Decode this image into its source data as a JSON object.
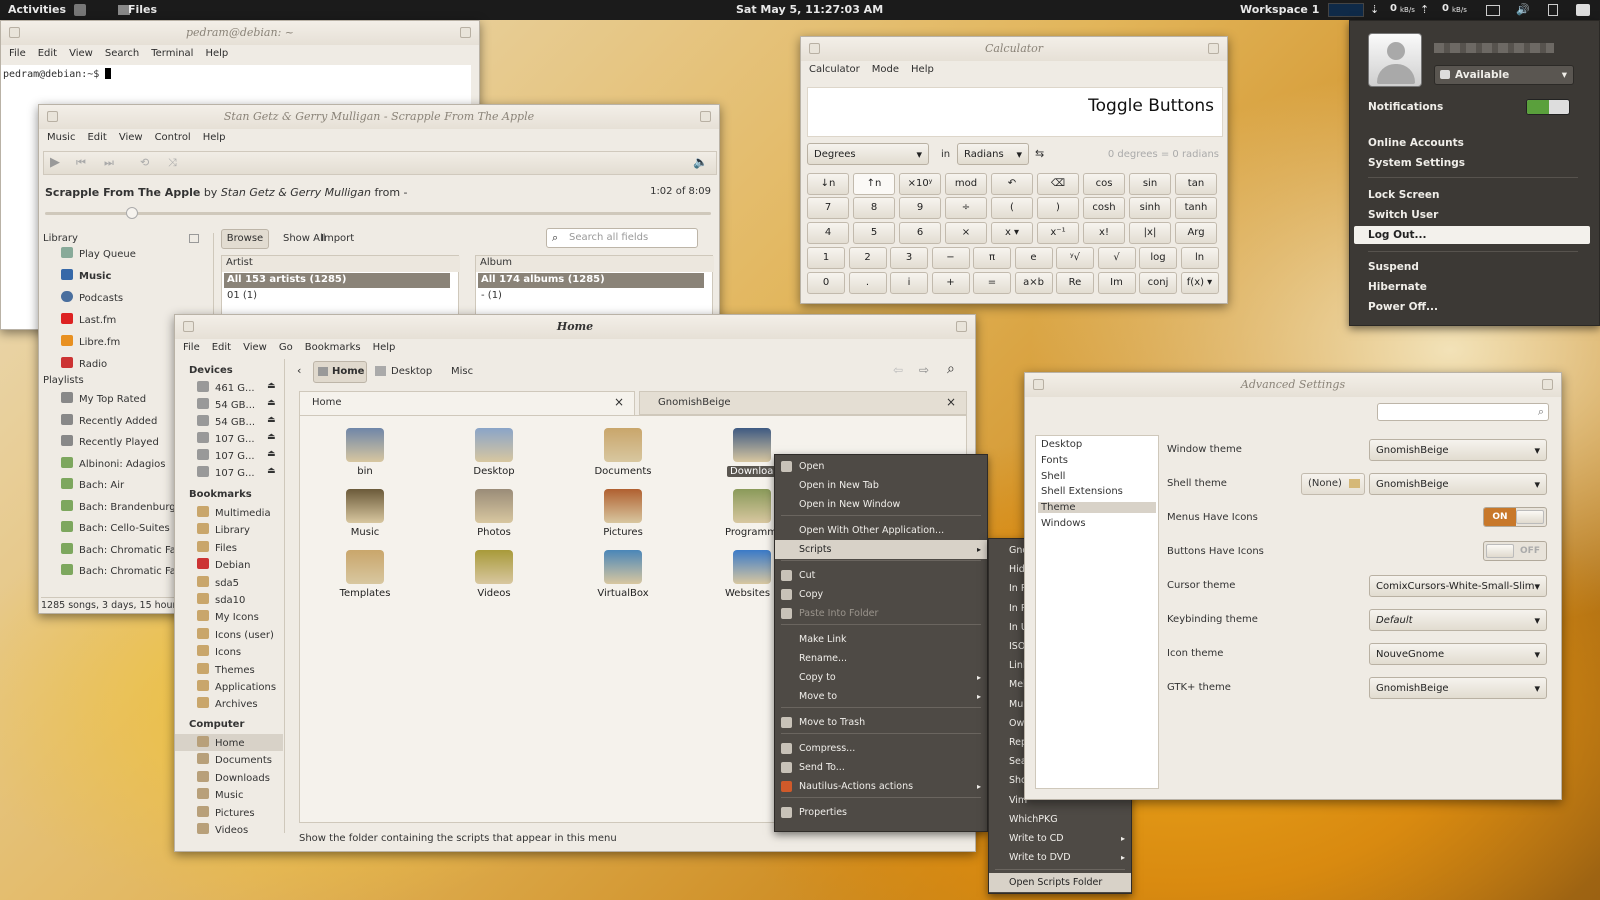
{
  "topbar": {
    "activities": "Activities",
    "app": "Files",
    "clock": "Sat May  5, 11:27:03 AM",
    "workspace": "Workspace 1",
    "down_rate": "0",
    "up_rate": "0",
    "rate_unit": "kB/s"
  },
  "terminal": {
    "title": "pedram@debian: ~",
    "menu": [
      "File",
      "Edit",
      "View",
      "Search",
      "Terminal",
      "Help"
    ],
    "prompt": "pedram@debian:~$"
  },
  "rhythmbox": {
    "title": "Stan Getz & Gerry Mulligan - Scrapple From The Apple",
    "menu": [
      "Music",
      "Edit",
      "View",
      "Control",
      "Help"
    ],
    "song": "Scrapple From The Apple",
    "by": "by",
    "artist": "Stan Getz & Gerry Mulligan",
    "from": "from -",
    "time": "1:02 of 8:09",
    "progress": 0.13,
    "library_label": "Library",
    "library": [
      "Play Queue",
      "Music",
      "Podcasts",
      "Last.fm",
      "Libre.fm",
      "Radio"
    ],
    "playlists_label": "Playlists",
    "playlists": [
      "My Top Rated",
      "Recently Added",
      "Recently Played",
      "Albinoni: Adagios",
      "Bach: Air",
      "Bach: Brandenburg",
      "Bach: Cello-Suites",
      "Bach: Chromatic Fa",
      "Bach: Chromatic Fa"
    ],
    "tabs": [
      "Browse",
      "Show All",
      "Import"
    ],
    "search_placeholder": "Search all fields",
    "artist_header": "Artist",
    "artist_rows": [
      "All 153 artists (1285)",
      "01 (1)"
    ],
    "album_header": "Album",
    "album_rows": [
      "All 174 albums (1285)",
      "- (1)"
    ],
    "status": "1285 songs, 3 days, 15 hour"
  },
  "calculator": {
    "title": "Calculator",
    "menu": [
      "Calculator",
      "Mode",
      "Help"
    ],
    "display": "Toggle Buttons",
    "angle_from": "Degrees",
    "in": "in",
    "angle_to": "Radians",
    "result": "0 degrees = 0 radians",
    "keys": [
      [
        "↓n",
        "↑n",
        "×10ʸ",
        "mod",
        "↶",
        "⌫",
        "cos",
        "sin",
        "tan"
      ],
      [
        "7",
        "8",
        "9",
        "÷",
        "(",
        ")",
        "cosh",
        "sinh",
        "tanh"
      ],
      [
        "4",
        "5",
        "6",
        "×",
        "x ▾",
        "x⁻¹",
        "x!",
        "|x|",
        "Arg"
      ],
      [
        "1",
        "2",
        "3",
        "−",
        "π",
        "e",
        "ʸ√",
        "√",
        "log",
        "ln"
      ],
      [
        "0",
        ".",
        "i",
        "+",
        "=",
        "a×b",
        "Re",
        "Im",
        "conj",
        "f(x) ▾"
      ]
    ]
  },
  "nautilus": {
    "title": "Home",
    "menu": [
      "File",
      "Edit",
      "View",
      "Go",
      "Bookmarks",
      "Help"
    ],
    "path": [
      "Home",
      "Desktop",
      "Misc"
    ],
    "devices_label": "Devices",
    "devices": [
      "461 G...",
      "54 GB...",
      "54 GB...",
      "107 G...",
      "107 G...",
      "107 G..."
    ],
    "bookmarks_label": "Bookmarks",
    "bookmarks": [
      "Multimedia",
      "Library",
      "Files",
      "Debian",
      "sda5",
      "sda10",
      "My Icons",
      "Icons (user)",
      "Icons",
      "Themes",
      "Applications",
      "Archives"
    ],
    "computer_label": "Computer",
    "computer": [
      "Home",
      "Documents",
      "Downloads",
      "Music",
      "Pictures",
      "Videos"
    ],
    "tabs": [
      "Home",
      "GnomishBeige"
    ],
    "files": [
      "bin",
      "Desktop",
      "Documents",
      "Download",
      "Music",
      "Photos",
      "Pictures",
      "Programm",
      "Templates",
      "Videos",
      "VirtualBox",
      "Websites"
    ],
    "status": "Show the folder containing the scripts that appear in this menu"
  },
  "context_menu": [
    "Open",
    "Open in New Tab",
    "Open in New Window",
    "Open With Other Application...",
    "Scripts",
    "Cut",
    "Copy",
    "Paste Into Folder",
    "Make Link",
    "Rename...",
    "Copy to",
    "Move to",
    "Move to Trash",
    "Compress...",
    "Send To...",
    "Nautilus-Actions actions",
    "Properties"
  ],
  "scripts_menu": [
    "Gnome Terminal",
    "Hide",
    "In Root Nautilus",
    "In Root Text Editor",
    "In User Text Editor",
    "ISO",
    "Link on Desktop",
    "Meld",
    "Multimedia",
    "Ownership",
    "Replace Text",
    "Search",
    "Show Permissions",
    "Vim",
    "WhichPKG",
    "Write to CD",
    "Write to DVD",
    "Open Scripts Folder"
  ],
  "advanced": {
    "title": "Advanced Settings",
    "categories": [
      "Desktop",
      "Fonts",
      "Shell",
      "Shell Extensions",
      "Theme",
      "Windows"
    ],
    "rows": [
      {
        "label": "Window theme",
        "value": "GnomishBeige"
      },
      {
        "label": "Shell theme",
        "value": "GnomishBeige",
        "extra": "(None)"
      },
      {
        "label": "Menus Have Icons",
        "toggle": "ON"
      },
      {
        "label": "Buttons Have Icons",
        "toggle": "OFF"
      },
      {
        "label": "Cursor theme",
        "value": "ComixCursors-White-Small-Slim"
      },
      {
        "label": "Keybinding theme",
        "value": "Default"
      },
      {
        "label": "Icon theme",
        "value": "NouveGnome"
      },
      {
        "label": "GTK+ theme",
        "value": "GnomishBeige"
      }
    ]
  },
  "user_menu": {
    "status": "Available",
    "notifications": "Notifications",
    "items": [
      "Online Accounts",
      "System Settings",
      "Lock Screen",
      "Switch User",
      "Log Out...",
      "Suspend",
      "Hibernate",
      "Power Off..."
    ]
  },
  "colors": {
    "menu_bg": "#4e4a45",
    "highlight": "#d8d2c8",
    "toggle_on": "#c8782a"
  }
}
